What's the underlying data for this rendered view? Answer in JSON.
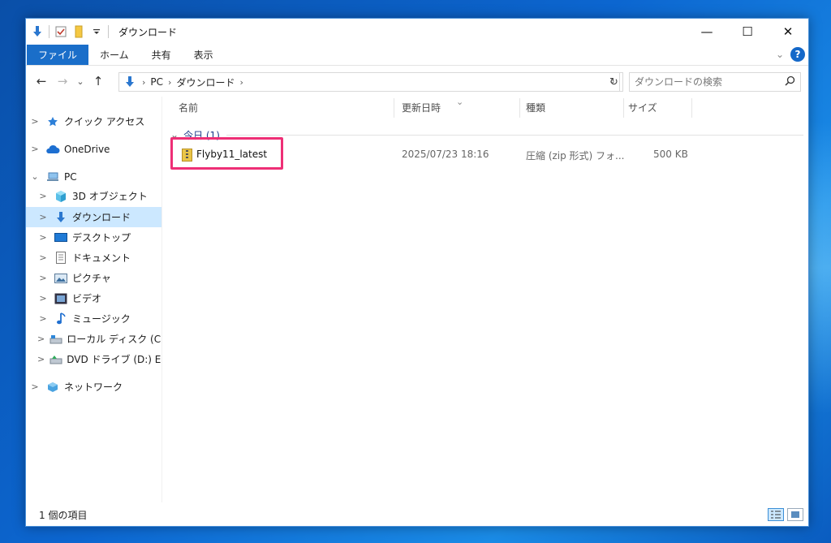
{
  "window": {
    "title": "ダウンロード"
  },
  "quick_access_toolbar": {
    "icons": [
      "download-arrow-icon",
      "properties-check-icon",
      "new-folder-icon",
      "customize-dropdown-icon"
    ]
  },
  "window_controls": {
    "minimize": "—",
    "maximize": "☐",
    "close": "✕"
  },
  "ribbon": {
    "tabs": [
      "ファイル",
      "ホーム",
      "共有",
      "表示"
    ],
    "expand_glyph": "⌄",
    "help_glyph": "?"
  },
  "address": {
    "back": "←",
    "forward": "→",
    "recent": "⌄",
    "up": "↑",
    "breadcrumbs": [
      "PC",
      "ダウンロード"
    ],
    "separator": "›",
    "dropdown": "⌄",
    "refresh": "↻"
  },
  "search": {
    "placeholder": "ダウンロードの検索",
    "icon": "search-icon"
  },
  "nav": {
    "items": [
      {
        "label": "クイック アクセス",
        "icon": "star-icon",
        "caret": ">",
        "indent": 0
      },
      {
        "label": "OneDrive",
        "icon": "cloud-icon",
        "caret": ">",
        "indent": 0
      },
      {
        "label": "PC",
        "icon": "computer-icon",
        "caret": "⌄",
        "indent": 0
      },
      {
        "label": "3D オブジェクト",
        "icon": "cube-icon",
        "caret": ">",
        "indent": 1
      },
      {
        "label": "ダウンロード",
        "icon": "download-arrow-icon",
        "caret": ">",
        "indent": 1,
        "selected": true
      },
      {
        "label": "デスクトップ",
        "icon": "desktop-icon",
        "caret": ">",
        "indent": 1
      },
      {
        "label": "ドキュメント",
        "icon": "document-icon",
        "caret": ">",
        "indent": 1
      },
      {
        "label": "ピクチャ",
        "icon": "picture-icon",
        "caret": ">",
        "indent": 1
      },
      {
        "label": "ビデオ",
        "icon": "film-icon",
        "caret": ">",
        "indent": 1
      },
      {
        "label": "ミュージック",
        "icon": "music-note-icon",
        "caret": ">",
        "indent": 1
      },
      {
        "label": "ローカル ディスク (C:)",
        "icon": "drive-icon",
        "caret": ">",
        "indent": 1
      },
      {
        "label": "DVD ドライブ (D:) ESI",
        "icon": "dvd-drive-icon",
        "caret": ">",
        "indent": 1
      },
      {
        "label": "ネットワーク",
        "icon": "network-icon",
        "caret": ">",
        "indent": 0
      }
    ]
  },
  "columns": {
    "name": "名前",
    "modified": "更新日時",
    "type": "種類",
    "size": "サイズ",
    "sort_glyph": "⌄"
  },
  "group": {
    "label": "今日 (1)",
    "caret": "⌄"
  },
  "files": [
    {
      "name": "Flyby11_latest",
      "modified": "2025/07/23 18:16",
      "type": "圧縮 (zip 形式) フォ...",
      "size": "500 KB",
      "icon": "zip-folder-icon",
      "highlighted": true,
      "highlight_color": "#ee2f76"
    }
  ],
  "status": {
    "item_count": "1 個の項目"
  },
  "colors": {
    "accent": "#1a6ec9",
    "selection": "#cce8ff",
    "highlight_box": "#ee2f76"
  }
}
